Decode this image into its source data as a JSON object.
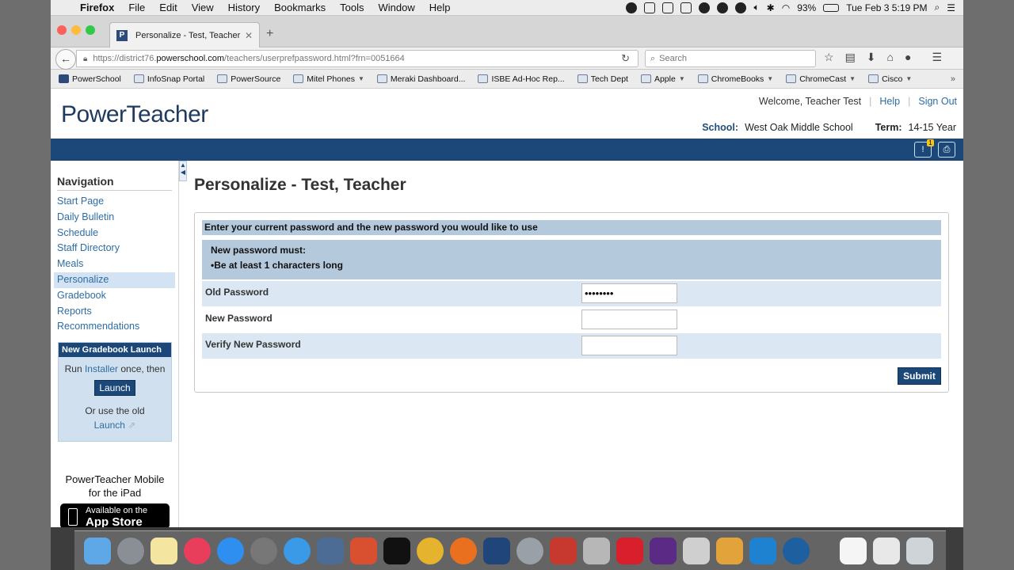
{
  "menubar": {
    "app": "Firefox",
    "items": [
      "File",
      "Edit",
      "View",
      "History",
      "Bookmarks",
      "Tools",
      "Window",
      "Help"
    ],
    "battery": "93%",
    "clock": "Tue Feb 3  5:19 PM"
  },
  "browser": {
    "tab_title": "Personalize - Test, Teacher",
    "tab_favicon": "P",
    "url_prefix": "https://district76.",
    "url_host": "powerschool.com",
    "url_path": "/teachers/userprefpassword.html?frn=0051664",
    "search_placeholder": "Search"
  },
  "bookmarks": [
    {
      "label": "PowerSchool",
      "folder": false
    },
    {
      "label": "InfoSnap Portal",
      "folder": false
    },
    {
      "label": "PowerSource",
      "folder": false
    },
    {
      "label": "Mitel Phones",
      "folder": true
    },
    {
      "label": "Meraki Dashboard...",
      "folder": false
    },
    {
      "label": "ISBE Ad-Hoc Rep...",
      "folder": false
    },
    {
      "label": "Tech Dept",
      "folder": false
    },
    {
      "label": "Apple",
      "folder": true
    },
    {
      "label": "ChromeBooks",
      "folder": true
    },
    {
      "label": "ChromeCast",
      "folder": true
    },
    {
      "label": "Cisco",
      "folder": true
    }
  ],
  "header": {
    "logo": "PowerTeacher",
    "welcome": "Welcome, Teacher Test",
    "help": "Help",
    "sign_out": "Sign Out",
    "school_label": "School:",
    "school": "West Oak Middle School",
    "term_label": "Term:",
    "term": "14-15 Year",
    "alert_count": "1"
  },
  "sidebar": {
    "heading": "Navigation",
    "items": [
      "Start Page",
      "Daily Bulletin",
      "Schedule",
      "Staff Directory",
      "Meals",
      "Personalize",
      "Gradebook",
      "Reports",
      "Recommendations"
    ],
    "active_index": 5,
    "gradebook_box": {
      "title": "New Gradebook Launch",
      "run": "Run",
      "installer": "Installer",
      "once_then": "once, then",
      "launch_button": "Launch",
      "or_use": "Or use the old",
      "old_launch": "Launch"
    },
    "mobile_line1": "PowerTeacher Mobile",
    "mobile_line2": "for the iPad",
    "appstore_small": "Available on the",
    "appstore_big": "App Store"
  },
  "main": {
    "title": "Personalize - Test, Teacher",
    "instructions": "Enter your current password and the new password you would like to use",
    "rules_heading": "New password must:",
    "rules_item": "•Be at least 1 characters long",
    "old_password_label": "Old Password",
    "old_password_value": "••••••••",
    "new_password_label": "New Password",
    "verify_password_label": "Verify New Password",
    "submit": "Submit"
  },
  "colors": {
    "accent": "#1b4878",
    "link": "#2d6da3",
    "row_highlight": "#dbe7f2"
  }
}
